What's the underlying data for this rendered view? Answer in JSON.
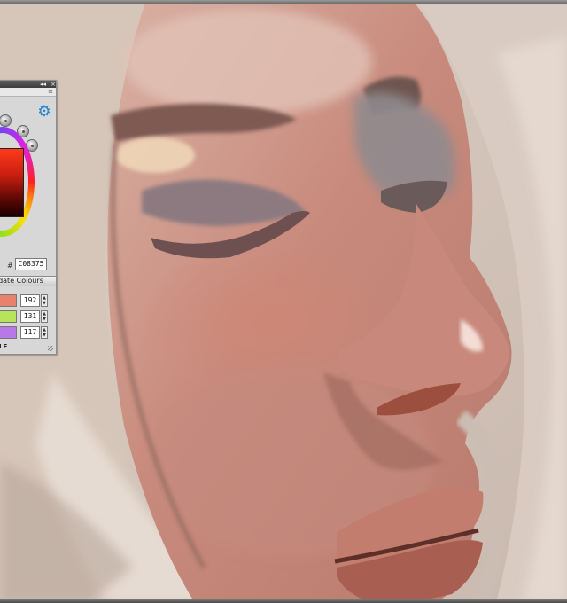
{
  "panel": {
    "hex_prefix": "#",
    "hex_value": "C08375",
    "update_button_label": "pdate Colours",
    "channels": [
      {
        "swatch_color": "#e8826d",
        "value": "192"
      },
      {
        "swatch_color": "#b6e45a",
        "value": "131"
      },
      {
        "swatch_color": "#b978e8",
        "value": "117"
      }
    ],
    "mode_label": "LE"
  },
  "colors": {
    "gear": "#1e86c9",
    "panel_bg": "#d7d7d7",
    "skin_base": "#c08375"
  }
}
